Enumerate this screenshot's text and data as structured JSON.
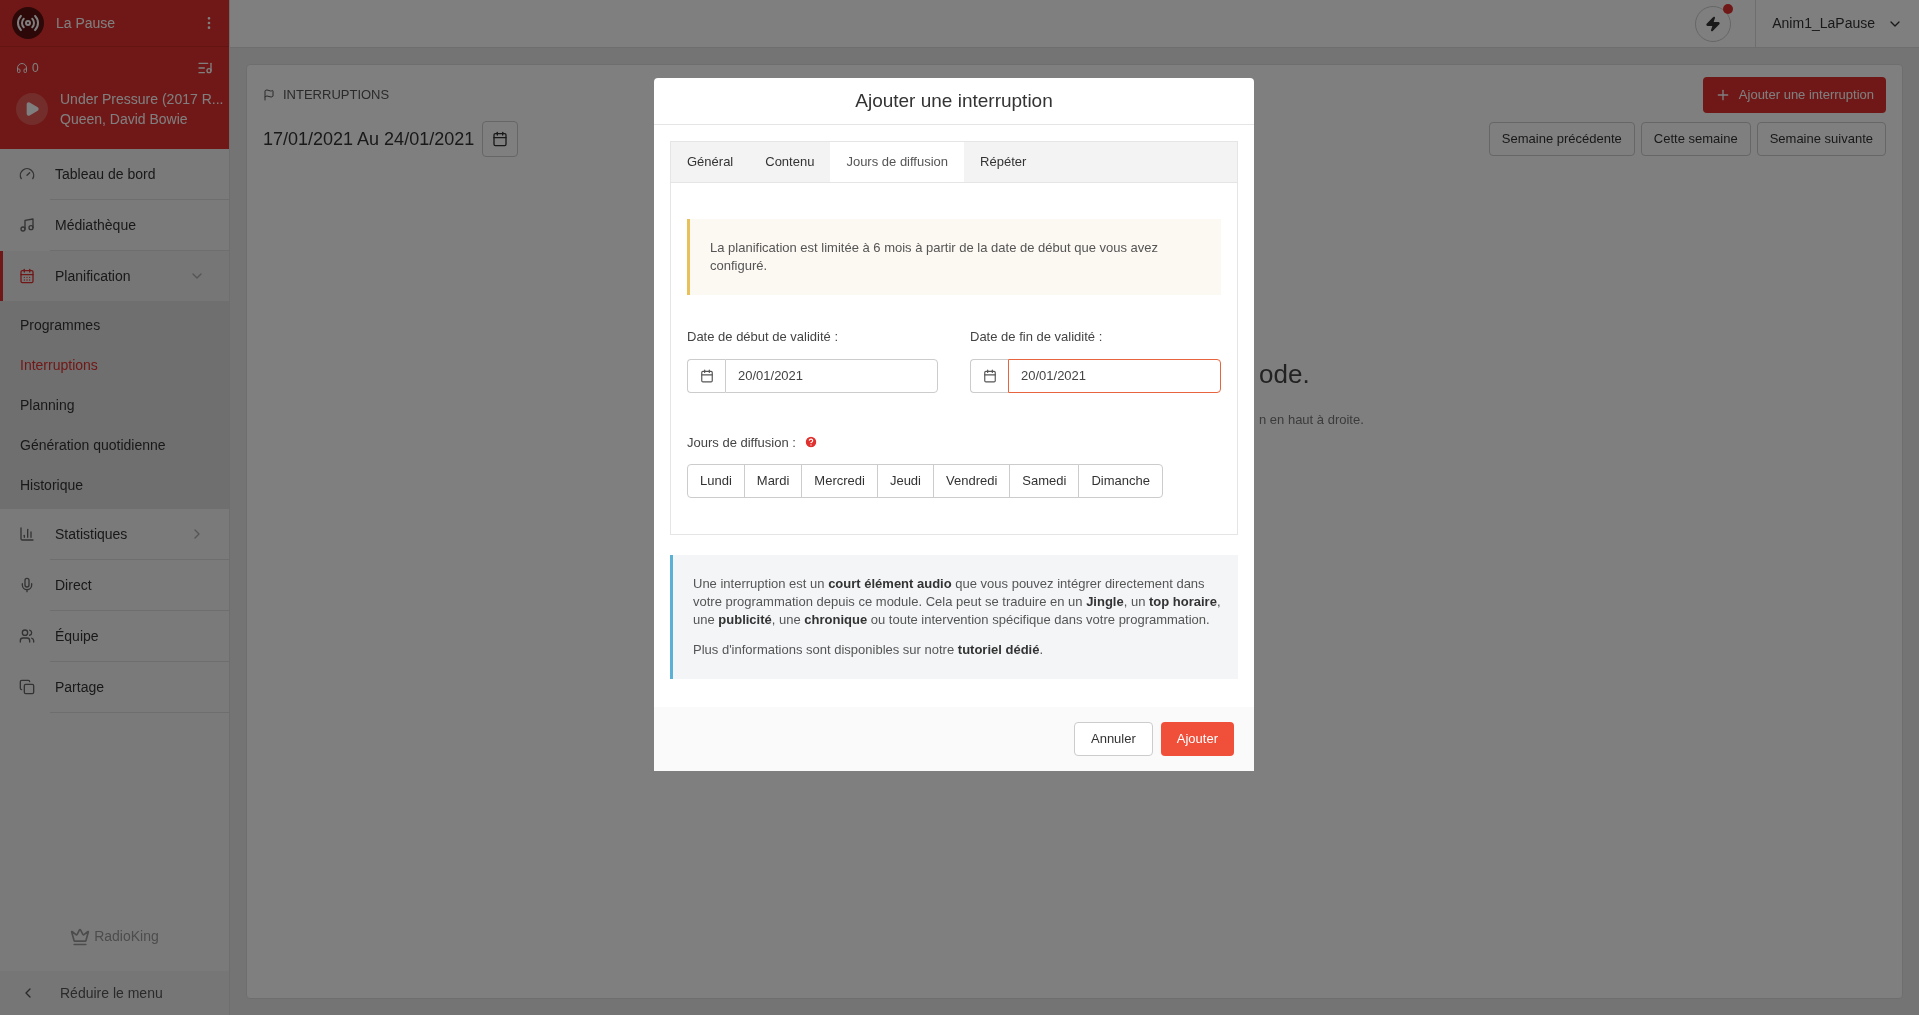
{
  "sidebar": {
    "station": "La Pause",
    "listeners": "0",
    "now_playing": {
      "title": "Under Pressure (2017 R...",
      "artist": "Queen, David Bowie"
    },
    "items": [
      {
        "label": "Tableau de bord",
        "selected": false
      },
      {
        "label": "Médiathèque",
        "selected": false
      },
      {
        "label": "Planification",
        "selected": true,
        "expanded": true,
        "children": [
          {
            "label": "Programmes",
            "selected": false
          },
          {
            "label": "Interruptions",
            "selected": true
          },
          {
            "label": "Planning",
            "selected": false
          },
          {
            "label": "Génération quotidienne",
            "selected": false
          },
          {
            "label": "Historique",
            "selected": false
          }
        ]
      },
      {
        "label": "Statistiques",
        "selected": false,
        "expanded": false
      },
      {
        "label": "Direct",
        "selected": false
      },
      {
        "label": "Équipe",
        "selected": false
      },
      {
        "label": "Partage",
        "selected": false
      }
    ],
    "brand": "RadioKing",
    "collapse": "Réduire le menu"
  },
  "header": {
    "user": "Anim1_LaPause",
    "notification": true
  },
  "page": {
    "breadcrumb": "INTERRUPTIONS",
    "add_button": "Ajouter une interruption",
    "date_range": "17/01/2021 Au 24/01/2021",
    "week_buttons": [
      "Semaine précédente",
      "Cette semaine",
      "Semaine suivante"
    ],
    "empty_title": "ode.",
    "empty_text": "n en haut à droite."
  },
  "modal": {
    "title": "Ajouter une interruption",
    "tabs": [
      {
        "label": "Général",
        "selected": false
      },
      {
        "label": "Contenu",
        "selected": false
      },
      {
        "label": "Jours de diffusion",
        "selected": true
      },
      {
        "label": "Répéter",
        "selected": false
      }
    ],
    "warning": "La planification est limitée à 6 mois à partir de la date de début que vous avez configuré.",
    "fields": [
      {
        "label": "Date de début de validité :",
        "value": "20/01/2021",
        "focused": false
      },
      {
        "label": "Date de fin de validité :",
        "value": "20/01/2021",
        "focused": true
      }
    ],
    "days_label": "Jours de diffusion :",
    "days": [
      {
        "label": "Lundi",
        "selected": false
      },
      {
        "label": "Mardi",
        "selected": false
      },
      {
        "label": "Mercredi",
        "selected": false
      },
      {
        "label": "Jeudi",
        "selected": false
      },
      {
        "label": "Vendredi",
        "selected": false
      },
      {
        "label": "Samedi",
        "selected": false
      },
      {
        "label": "Dimanche",
        "selected": false
      }
    ],
    "info": [
      "Une interruption est un **court élément audio** que vous pouvez intégrer directement dans votre programmation depuis ce module. Cela peut se traduire en un **Jingle**, un **top horaire**, une **publicité**, une **chronique** ou toute intervention spécifique dans votre programmation.",
      "Plus d'informations sont disponibles sur notre **tutoriel dédié**."
    ],
    "buttons": [
      {
        "label": "Annuler",
        "kind": "secondary"
      },
      {
        "label": "Ajouter",
        "kind": "primary"
      }
    ]
  }
}
